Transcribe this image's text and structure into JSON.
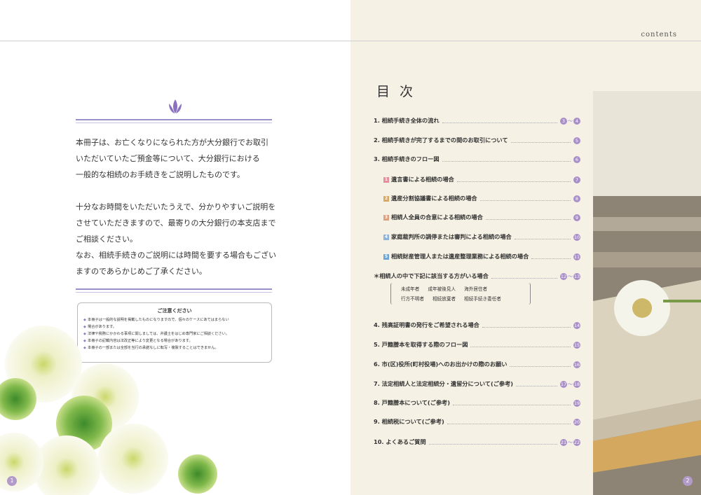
{
  "header": {
    "contents_label": "contents"
  },
  "intro": {
    "lines": [
      "本冊子は、お亡くなりになられた方が大分銀行でお取引",
      "いただいていたご預金等について、大分銀行における",
      "一般的な相続のお手続きをご説明したものです。",
      "",
      "十分なお時間をいただいたうえで、分かりやすいご説明を",
      "させていただきますので、最寄りの大分銀行の本支店まで",
      "ご相談ください。",
      "なお、相続手続きのご説明には時間を要する場合もござい",
      "ますのであらかじめご了承ください。"
    ]
  },
  "notice": {
    "title": "ご注意ください",
    "items": [
      "本冊子は一般的な説明を掲載したものになりますので、個々のケースにあてはまらない",
      "場合があります。",
      "法律や税務にかかわる事項に関しましては、弁護士をはじめ専門家にご相談ください。",
      "本冊子の記載内容は法改正等により変更となる場合があります。",
      "本冊子の一部または全部を当行の承諾なしに転写・複製することはできません。"
    ]
  },
  "page_numbers": {
    "left": "1",
    "right": "2"
  },
  "toc": {
    "title": "目次",
    "entries": [
      {
        "label": "1. 相続手続き全体の流れ",
        "from": "3",
        "to": "4"
      },
      {
        "label": "2. 相続手続きが完了するまでの間のお取引について",
        "from": "5",
        "to": ""
      },
      {
        "label": "3. 相続手続きのフロー図",
        "from": "6",
        "to": ""
      },
      {
        "num": "1",
        "label": "遺言書による相続の場合",
        "from": "7",
        "to": ""
      },
      {
        "num": "2",
        "label": "遺産分割協議書による相続の場合",
        "from": "8",
        "to": ""
      },
      {
        "num": "3",
        "label": "相続人全員の合意による相続の場合",
        "from": "9",
        "to": ""
      },
      {
        "num": "4",
        "label": "家庭裁判所の調停または審判による相続の場合",
        "from": "10",
        "to": ""
      },
      {
        "num": "5",
        "label": "相続財産管理人または遺産整理業務による相続の場合",
        "from": "11",
        "to": ""
      },
      {
        "label": "＊相続人の中で下記に該当する方がいる場合",
        "from": "12",
        "to": "13"
      },
      {
        "label": "4. 残高証明書の発行をご希望される場合",
        "from": "14",
        "to": ""
      },
      {
        "label": "5. 戸籍謄本を取得する際のフロー図",
        "from": "15",
        "to": ""
      },
      {
        "label": "6. 市(区)役所(町村役場)へのお出かけの際のお願い",
        "from": "16",
        "to": ""
      },
      {
        "label": "7. 法定相続人と法定相続分・遺留分について(ご参考)",
        "from": "17",
        "to": "18"
      },
      {
        "label": "8. 戸籍謄本について(ご参考)",
        "from": "19",
        "to": ""
      },
      {
        "label": "9. 相続税について(ご参考)",
        "from": "20",
        "to": ""
      },
      {
        "label": "10. よくあるご質問",
        "from": "21",
        "to": "22"
      }
    ],
    "tilde": "～",
    "sub_list": {
      "row1": [
        "未成年者",
        "成年被後見人",
        "海外居住者"
      ],
      "row2": [
        "行方不明者",
        "相続放棄者",
        "相続手続き委任者"
      ]
    },
    "square_colors": [
      "#e58f9b",
      "#d8a866",
      "#dfa080",
      "#8fb3d9",
      "#6fa5d4"
    ]
  },
  "colors": {
    "accent": "#a98fc8",
    "rule": "#9a8fc8",
    "right_bg": "#f5f1e4"
  }
}
